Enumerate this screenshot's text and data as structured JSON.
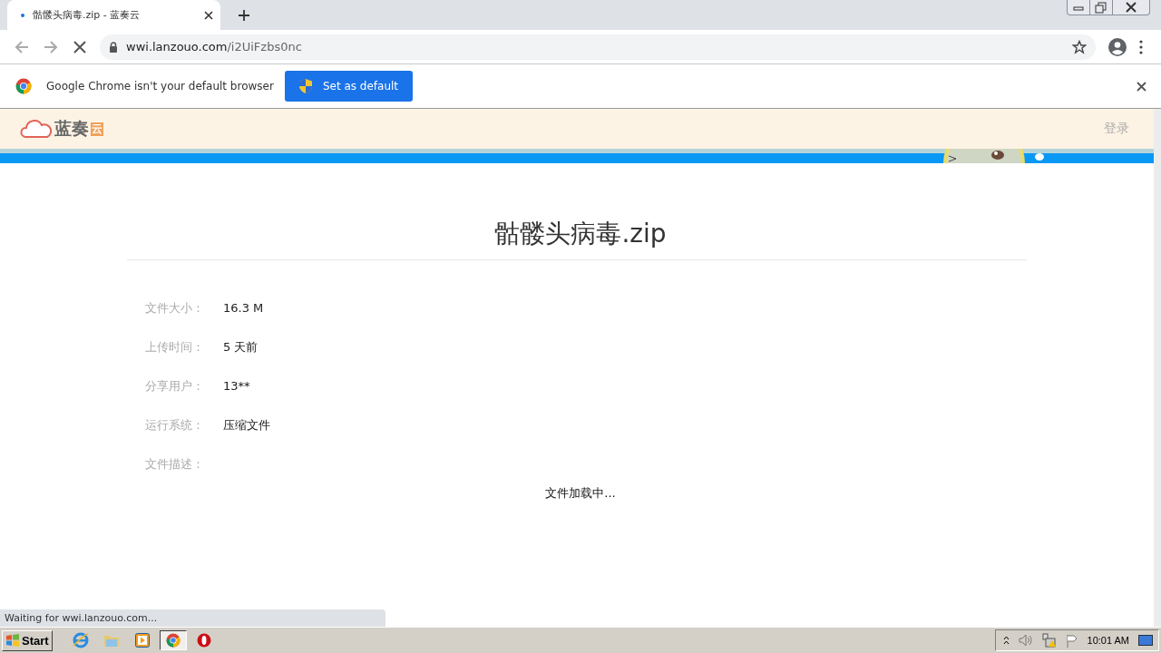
{
  "browser": {
    "tab": {
      "title": "骷髅头病毒.zip - 蓝奏云",
      "selected": true
    },
    "loading": true,
    "url": {
      "host": "wwi.lanzouo.com",
      "path": "/i2UiFzbs0nc"
    },
    "status": "Waiting for wwi.lanzouo.com..."
  },
  "infobar": {
    "message": "Google Chrome isn't your default browser",
    "button": "Set as default"
  },
  "site": {
    "logo": "蓝奏",
    "logo_badge": "云",
    "login": "登录",
    "title": "骷髅头病毒.zip",
    "fields": [
      {
        "label": "文件大小：",
        "value": "16.3 M"
      },
      {
        "label": "上传时间：",
        "value": "5 天前"
      },
      {
        "label": "分享用户：",
        "value": "13**"
      },
      {
        "label": "运行系统：",
        "value": "压缩文件"
      },
      {
        "label": "文件描述："
      }
    ],
    "loading_text": "文件加载中..."
  },
  "taskbar": {
    "start": "Start",
    "apps": [
      {
        "kind": "ie",
        "selected": false
      },
      {
        "kind": "folder",
        "selected": false
      },
      {
        "kind": "media",
        "selected": false
      },
      {
        "kind": "chrome",
        "selected": true
      },
      {
        "kind": "opera",
        "selected": false
      }
    ],
    "clock": "10:01 AM"
  }
}
